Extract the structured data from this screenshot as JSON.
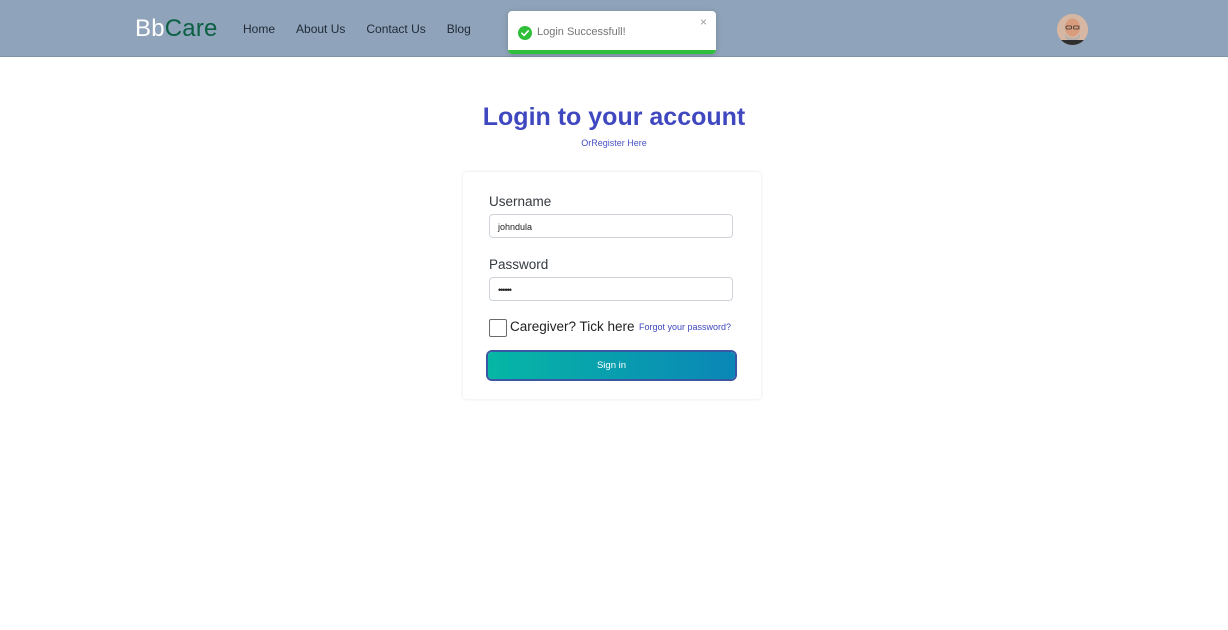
{
  "header": {
    "brand_part1": "Bb",
    "brand_part2": "Care",
    "nav": [
      "Home",
      "About Us",
      "Contact Us",
      "Blog"
    ]
  },
  "toast": {
    "message": "Login Successfull!",
    "close": "×"
  },
  "login": {
    "title": "Login to your account",
    "or": "Or",
    "register": "Register Here",
    "username_label": "Username",
    "username_value": "johndula",
    "password_label": "Password",
    "password_value": "••••••",
    "caregiver_label": "Caregiver? Tick here",
    "forgot": "Forgot your password?",
    "signin": "Sign in"
  },
  "colors": {
    "navbar": "#8fa3ba",
    "accent": "#4048c0",
    "brand_green": "#0b5f43",
    "success": "#2fbf3a"
  },
  "icons": {
    "toast_icon": "check-circle-icon",
    "avatar": "user-avatar"
  }
}
